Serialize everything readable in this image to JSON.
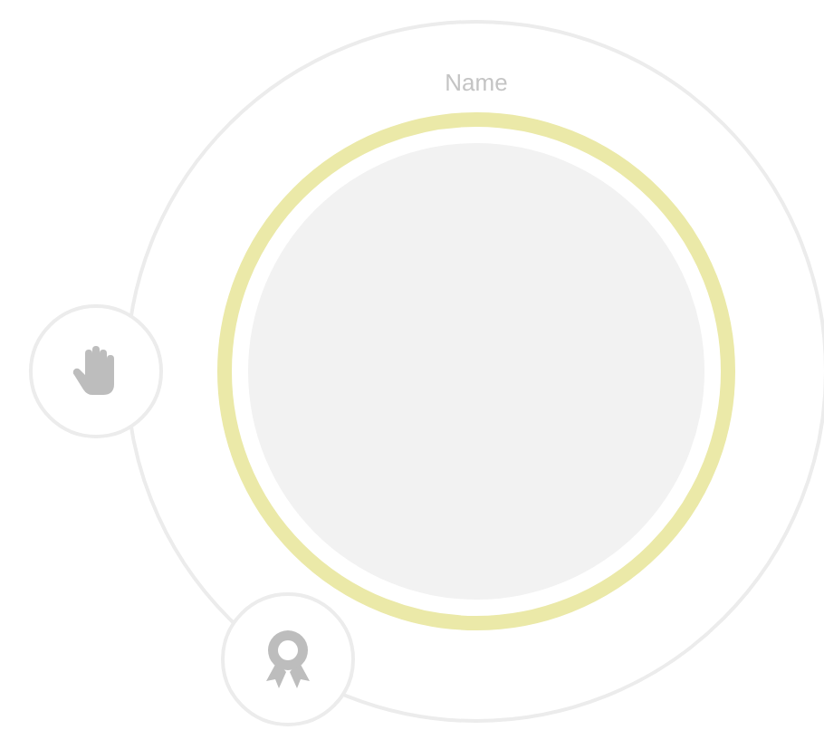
{
  "name_label": "Name",
  "actions": [
    {
      "kind": "hand"
    },
    {
      "kind": "award"
    }
  ]
}
